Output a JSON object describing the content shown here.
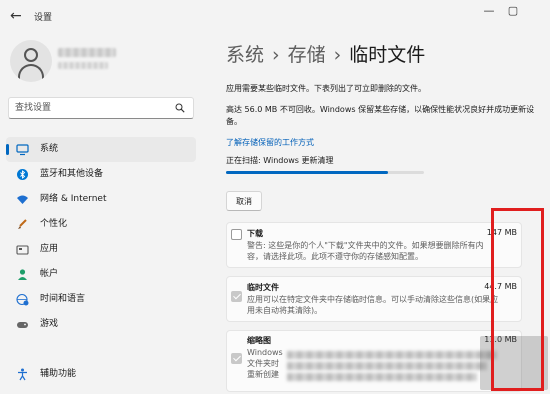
{
  "app": {
    "title": "设置"
  },
  "window_controls": [
    "—",
    "▢"
  ],
  "search": {
    "placeholder": "查找设置"
  },
  "sidebar": {
    "items": [
      {
        "label": "系统",
        "icon": "monitor-icon",
        "active": true
      },
      {
        "label": "蓝牙和其他设备",
        "icon": "bluetooth-icon",
        "active": false
      },
      {
        "label": "网络 & Internet",
        "icon": "wifi-icon",
        "active": false
      },
      {
        "label": "个性化",
        "icon": "brush-icon",
        "active": false
      },
      {
        "label": "应用",
        "icon": "apps-icon",
        "active": false
      },
      {
        "label": "帐户",
        "icon": "person-icon",
        "active": false
      },
      {
        "label": "时间和语言",
        "icon": "globe-clock-icon",
        "active": false
      },
      {
        "label": "游戏",
        "icon": "gamepad-icon",
        "active": false
      },
      {
        "label": "辅助功能",
        "icon": "accessibility-icon",
        "active": false
      }
    ]
  },
  "breadcrumb": {
    "level1": "系统",
    "sep1": "›",
    "level2": "存储",
    "sep2": "›",
    "current": "临时文件"
  },
  "main": {
    "intro": "应用需要某些临时文件。下表列出了可立即删除的文件。",
    "recovery_note": "高达 56.0 MB 不可回收。Windows 保留某些存储，以确保性能状况良好并成功更新设备。",
    "link": "了解存储保留的工作方式",
    "scan_label": "正在扫描: Windows 更新清理",
    "scan_progress": 0.82,
    "cancel_label": "取消"
  },
  "items": [
    {
      "title": "下载",
      "size": "147 MB",
      "checked": false,
      "desc": "警告: 这些是你的个人\"下载\"文件夹中的文件。如果想要删除所有内容，请选择此项。此项不遵守你的存储感知配置。"
    },
    {
      "title": "临时文件",
      "size": "44.7 MB",
      "checked": true,
      "desc": "应用可以在特定文件夹中存储临时信息。可以手动清除这些信息(如果应用未自动将其清除)。"
    },
    {
      "title": "缩略图",
      "size": "11.0 MB",
      "checked": true,
      "desc_lines": [
        "Windows",
        "文件夹时",
        "重新创建"
      ]
    }
  ],
  "colors": {
    "accent": "#0067c0",
    "link": "#005fb8",
    "highlight": "#e01e1e"
  }
}
